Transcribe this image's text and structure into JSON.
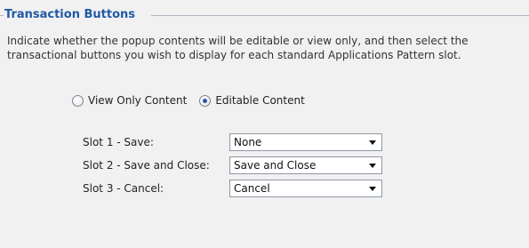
{
  "section": {
    "title": "Transaction Buttons"
  },
  "instructions": {
    "line1": "Indicate whether the popup contents will be editable or view only, and then select the",
    "line2": "transactional buttons you wish to display for each standard Applications Pattern slot."
  },
  "content_mode": {
    "options": [
      {
        "label": "View Only Content",
        "selected": false
      },
      {
        "label": "Editable Content",
        "selected": true
      }
    ]
  },
  "slots": [
    {
      "label": "Slot 1 - Save:",
      "value": "None"
    },
    {
      "label": "Slot 2 - Save and Close:",
      "value": "Save and Close"
    },
    {
      "label": "Slot 3 - Cancel:",
      "value": "Cancel"
    }
  ],
  "icons": {
    "dropdown": "chevron-down-icon",
    "radio": "radio-icon"
  },
  "colors": {
    "header_title": "#1f5aa6",
    "panel_background": "#f1f1f1",
    "rule": "#aeb6c2",
    "radio_dot": "#2a56a8"
  }
}
